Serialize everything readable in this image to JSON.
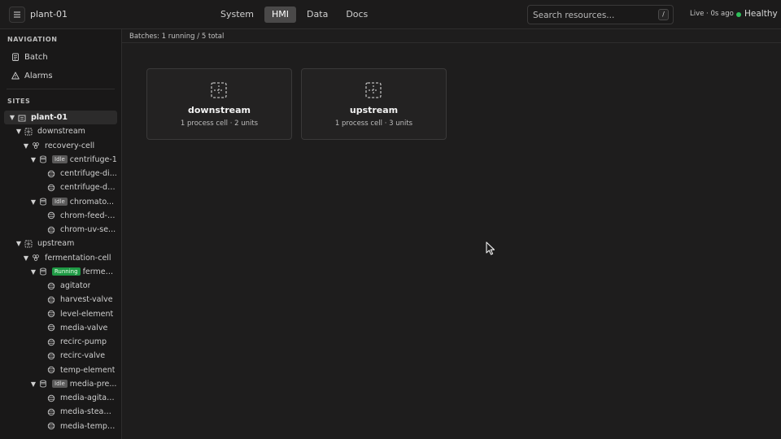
{
  "header": {
    "project": "plant-01",
    "tabs": [
      {
        "label": "System",
        "active": false
      },
      {
        "label": "HMI",
        "active": true
      },
      {
        "label": "Data",
        "active": false
      },
      {
        "label": "Docs",
        "active": false
      }
    ],
    "search_placeholder": "Search resources...",
    "search_shortcut": "/",
    "live_status": "Live · 0s ago",
    "health": "Healthy",
    "health_color": "#2fbf5a"
  },
  "sidebar": {
    "navigation_title": "NAVIGATION",
    "nav_items": [
      {
        "label": "Batch",
        "icon": "clipboard-icon"
      },
      {
        "label": "Alarms",
        "icon": "warning-icon"
      }
    ],
    "sites_title": "SITES",
    "tree": [
      {
        "label": "plant-01",
        "type": "site"
      },
      {
        "label": "downstream",
        "type": "area"
      },
      {
        "label": "recovery-cell",
        "type": "cell"
      },
      {
        "label": "centrifuge-1",
        "type": "unit",
        "badge": "Idle"
      },
      {
        "label": "centrifuge-di...",
        "type": "equipment"
      },
      {
        "label": "centrifuge-dri...",
        "type": "equipment"
      },
      {
        "label": "chromato...",
        "type": "unit",
        "badge": "Idle"
      },
      {
        "label": "chrom-feed-p...",
        "type": "equipment"
      },
      {
        "label": "chrom-uv-se...",
        "type": "equipment"
      },
      {
        "label": "upstream",
        "type": "area"
      },
      {
        "label": "fermentation-cell",
        "type": "cell"
      },
      {
        "label": "fermen...",
        "type": "unit",
        "badge": "Running"
      },
      {
        "label": "agitator",
        "type": "equipment"
      },
      {
        "label": "harvest-valve",
        "type": "equipment"
      },
      {
        "label": "level-element",
        "type": "equipment"
      },
      {
        "label": "media-valve",
        "type": "equipment"
      },
      {
        "label": "recirc-pump",
        "type": "equipment"
      },
      {
        "label": "recirc-valve",
        "type": "equipment"
      },
      {
        "label": "temp-element",
        "type": "equipment"
      },
      {
        "label": "media-pre...",
        "type": "unit",
        "badge": "Idle"
      },
      {
        "label": "media-agitator",
        "type": "equipment"
      },
      {
        "label": "media-steam...",
        "type": "equipment"
      },
      {
        "label": "media-temp-...",
        "type": "equipment"
      }
    ]
  },
  "main": {
    "batch_summary": "Batches: 1 running / 5 total",
    "areas": [
      {
        "name": "downstream",
        "summary": "1 process cell · 2 units"
      },
      {
        "name": "upstream",
        "summary": "1 process cell · 3 units"
      }
    ]
  },
  "colors": {
    "running": "#1f9a45",
    "idle": "#5a5959",
    "active_tab": "#4a4949"
  }
}
